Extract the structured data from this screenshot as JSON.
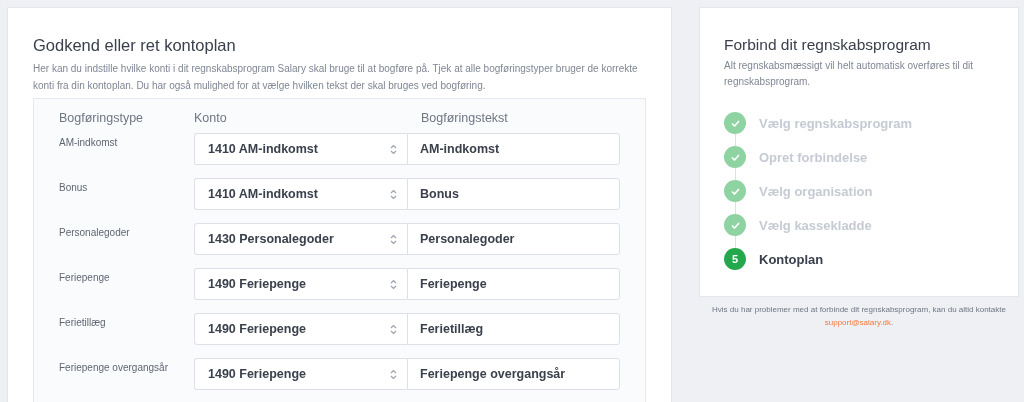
{
  "main": {
    "title": "Godkend eller ret kontoplan",
    "description": "Her kan du indstille hvilke konti i dit regnskabsprogram Salary skal bruge til at bogføre på. Tjek at alle bogføringstyper bruger de korrekte konti fra din kontoplan. Du har også mulighed for at vælge hvilken tekst der skal bruges ved bogføring.",
    "columns": [
      "Bogføringstype",
      "Konto",
      "Bogføringstekst"
    ],
    "rows": [
      {
        "type": "AM-indkomst",
        "account": "1410 AM-indkomst",
        "text": "AM-indkomst"
      },
      {
        "type": "Bonus",
        "account": "1410 AM-indkomst",
        "text": "Bonus"
      },
      {
        "type": "Personalegoder",
        "account": "1430 Personalegoder",
        "text": "Personalegoder"
      },
      {
        "type": "Feriepenge",
        "account": "1490 Feriepenge",
        "text": "Feriepenge"
      },
      {
        "type": "Ferietillæg",
        "account": "1490 Feriepenge",
        "text": "Ferietillæg"
      },
      {
        "type": "Feriepenge overgangsår",
        "account": "1490 Feriepenge",
        "text": "Feriepenge overgangsår"
      }
    ]
  },
  "side": {
    "title": "Forbind dit regnskabsprogram",
    "description": "Alt regnskabsmæssigt vil helt automatisk overføres til dit regnskabsprogram.",
    "steps": [
      {
        "label": "Vælg regnskabsprogram",
        "done": true
      },
      {
        "label": "Opret forbindelse",
        "done": true
      },
      {
        "label": "Vælg organisation",
        "done": true
      },
      {
        "label": "Vælg kassekladde",
        "done": true
      },
      {
        "label": "Kontoplan",
        "done": false,
        "number": "5"
      }
    ],
    "help": "Hvis du har problemer med at forbinde dit regnskabsprogram, kan du altid kontakte ",
    "help_link": "support@salary.dk",
    "help_end": "."
  }
}
